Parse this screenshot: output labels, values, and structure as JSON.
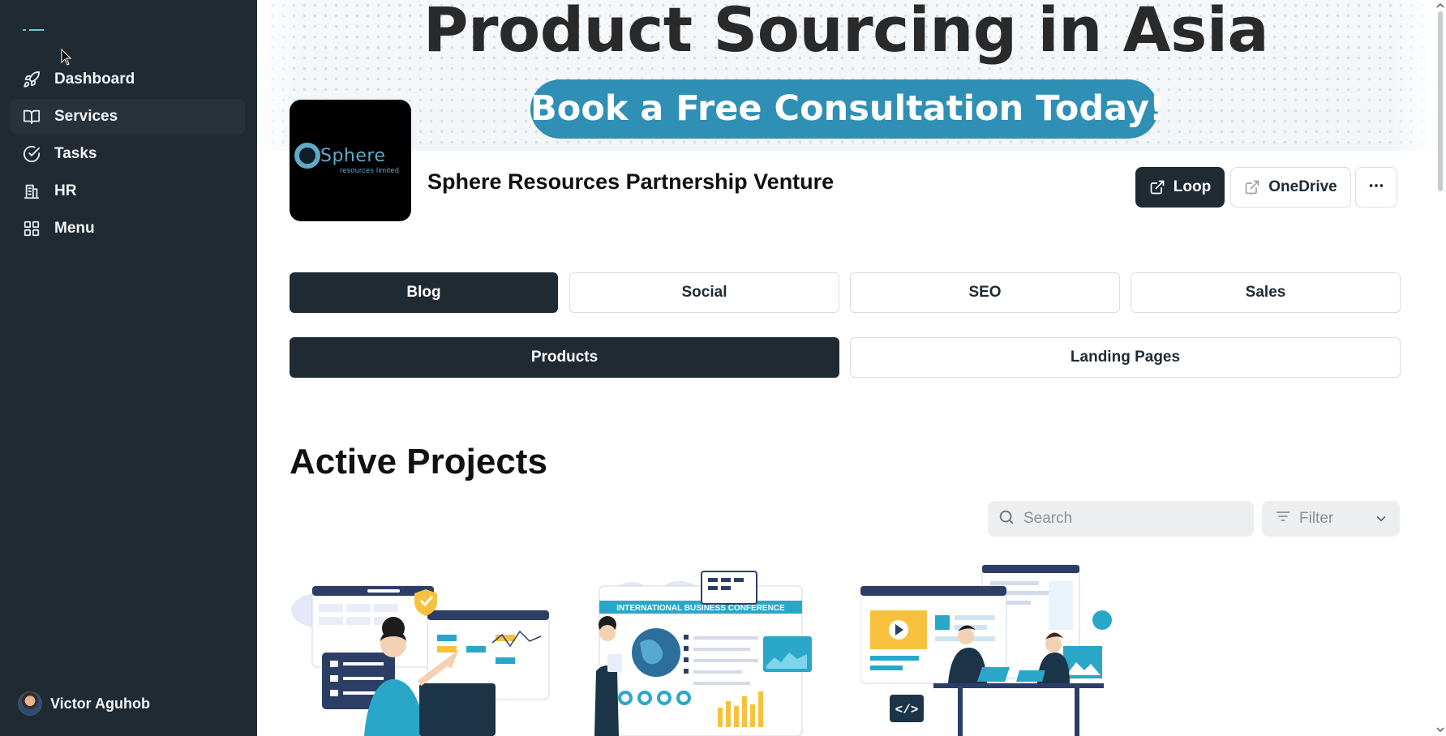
{
  "sidebar": {
    "items": [
      {
        "label": "Dashboard",
        "icon": "rocket-icon"
      },
      {
        "label": "Services",
        "icon": "book-icon",
        "active": true
      },
      {
        "label": "Tasks",
        "icon": "check-circle-icon"
      },
      {
        "label": "HR",
        "icon": "building-icon"
      },
      {
        "label": "Menu",
        "icon": "grid-icon"
      }
    ],
    "user": {
      "name": "Victor Aguhob"
    }
  },
  "banner": {
    "title": "Product Sourcing in Asia",
    "cta": "Book a Free Consultation Today!"
  },
  "company": {
    "name": "Sphere Resources Partnership Venture",
    "logo_text": "Sphere",
    "logo_subtext": "resources limited"
  },
  "actions": {
    "loop_label": "Loop",
    "onedrive_label": "OneDrive",
    "more_icon": "more-horizontal-icon"
  },
  "tabs_row1": [
    {
      "label": "Blog",
      "active": true
    },
    {
      "label": "Social",
      "active": false
    },
    {
      "label": "SEO",
      "active": false
    },
    {
      "label": "Sales",
      "active": false
    }
  ],
  "tabs_row2": [
    {
      "label": "Products",
      "active": true
    },
    {
      "label": "Landing Pages",
      "active": false
    }
  ],
  "projects": {
    "title": "Active Projects",
    "search_placeholder": "Search",
    "filter_label": "Filter",
    "cards": [
      {
        "illustration": "dashboard-analytics-illustration"
      },
      {
        "illustration": "conference-presentation-illustration",
        "caption": "INTERNATIONAL BUSINESS CONFERENCE"
      },
      {
        "illustration": "web-development-illustration"
      }
    ]
  },
  "colors": {
    "sidebar_bg": "#1f2a33",
    "accent": "#2f8fb4",
    "dark_button": "#1f2a33"
  }
}
